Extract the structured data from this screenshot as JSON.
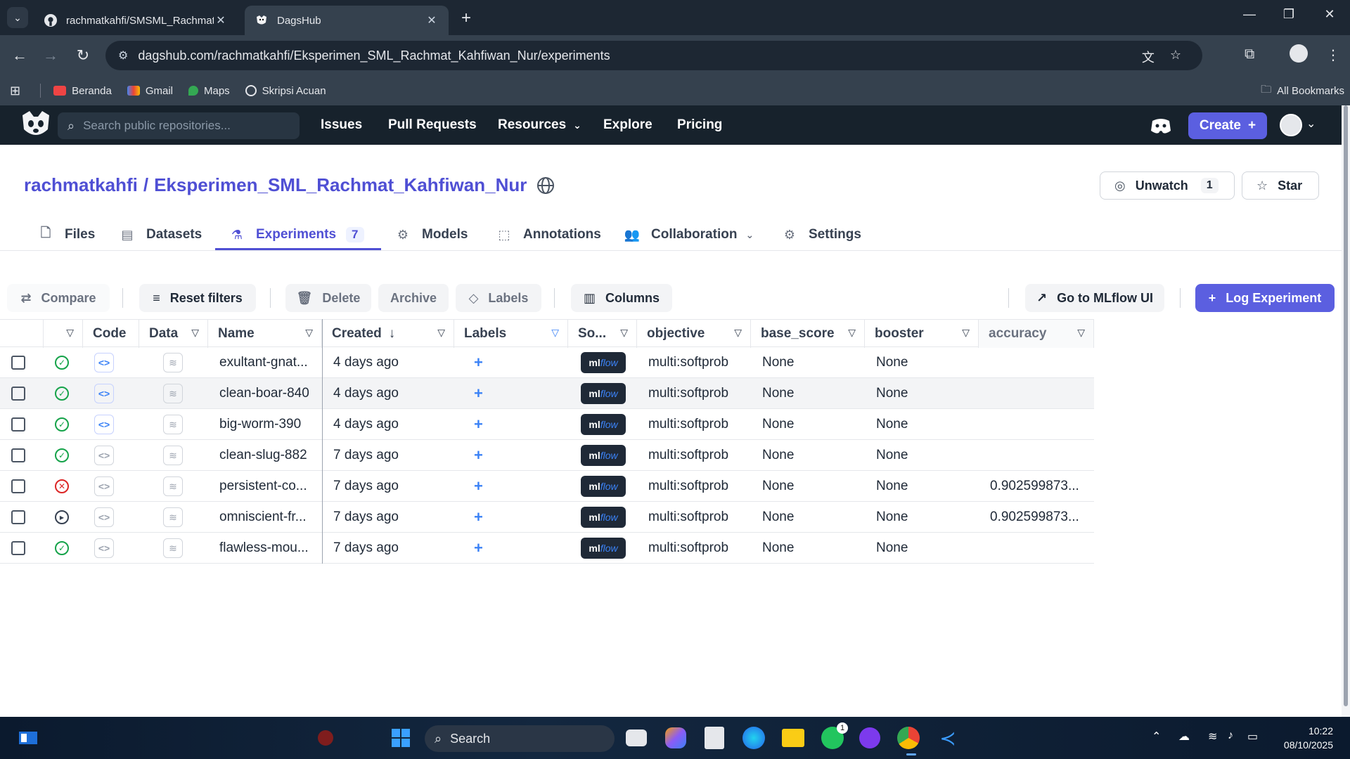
{
  "browser": {
    "tabs": [
      {
        "title": "rachmatkahfi/SMSML_Rachmat",
        "active": false
      },
      {
        "title": "DagsHub",
        "active": true
      }
    ],
    "url": "dagshub.com/rachmatkahfi/Eksperimen_SML_Rachmat_Kahfiwan_Nur/experiments",
    "bookmarks": [
      "Beranda",
      "Gmail",
      "Maps",
      "Skripsi Acuan"
    ],
    "all_bookmarks": "All Bookmarks"
  },
  "header": {
    "search_placeholder": "Search public repositories...",
    "nav": [
      "Issues",
      "Pull Requests",
      "Resources",
      "Explore",
      "Pricing"
    ],
    "create_label": "Create"
  },
  "repo": {
    "owner": "rachmatkahfi",
    "separator": "/",
    "name": "Eksperimen_SML_Rachmat_Kahfiwan_Nur",
    "unwatch_label": "Unwatch",
    "watch_count": "1",
    "star_label": "Star"
  },
  "repo_tabs": [
    {
      "label": "Files"
    },
    {
      "label": "Datasets"
    },
    {
      "label": "Experiments",
      "badge": "7",
      "active": true
    },
    {
      "label": "Models"
    },
    {
      "label": "Annotations"
    },
    {
      "label": "Collaboration"
    },
    {
      "label": "Settings"
    }
  ],
  "actions": {
    "compare": "Compare",
    "reset_filters": "Reset filters",
    "delete": "Delete",
    "archive": "Archive",
    "labels": "Labels",
    "columns": "Columns",
    "go_mlflow": "Go to MLflow UI",
    "log_experiment": "Log Experiment"
  },
  "table": {
    "headers": {
      "code": "Code",
      "data": "Data",
      "name": "Name",
      "created": "Created",
      "labels": "Labels",
      "source": "So...",
      "objective": "objective",
      "base_score": "base_score",
      "booster": "booster",
      "accuracy": "accuracy"
    },
    "source_badge": {
      "ml": "ml",
      "flow": "flow"
    },
    "rows": [
      {
        "status": "success",
        "code_on": true,
        "name": "exultant-gnat...",
        "created": "4 days ago",
        "objective": "multi:softprob",
        "base_score": "None",
        "booster": "None",
        "accuracy": ""
      },
      {
        "status": "success",
        "code_on": true,
        "name": "clean-boar-840",
        "created": "4 days ago",
        "objective": "multi:softprob",
        "base_score": "None",
        "booster": "None",
        "accuracy": ""
      },
      {
        "status": "success",
        "code_on": true,
        "name": "big-worm-390",
        "created": "4 days ago",
        "objective": "multi:softprob",
        "base_score": "None",
        "booster": "None",
        "accuracy": ""
      },
      {
        "status": "success",
        "code_on": false,
        "name": "clean-slug-882",
        "created": "7 days ago",
        "objective": "multi:softprob",
        "base_score": "None",
        "booster": "None",
        "accuracy": ""
      },
      {
        "status": "failed",
        "code_on": false,
        "name": "persistent-co...",
        "created": "7 days ago",
        "objective": "multi:softprob",
        "base_score": "None",
        "booster": "None",
        "accuracy": "0.902599873..."
      },
      {
        "status": "running",
        "code_on": false,
        "name": "omniscient-fr...",
        "created": "7 days ago",
        "objective": "multi:softprob",
        "base_score": "None",
        "booster": "None",
        "accuracy": "0.902599873..."
      },
      {
        "status": "success",
        "code_on": false,
        "name": "flawless-mou...",
        "created": "7 days ago",
        "objective": "multi:softprob",
        "base_score": "None",
        "booster": "None",
        "accuracy": ""
      }
    ]
  },
  "taskbar": {
    "search": "Search",
    "time": "10:22",
    "date": "08/10/2025",
    "whatsapp_badge": "1"
  },
  "colors": {
    "accent": "#5b5fe0",
    "link": "#4f4fd4",
    "header_bg": "#17222c",
    "success": "#16a34a",
    "failed": "#dc2626"
  }
}
